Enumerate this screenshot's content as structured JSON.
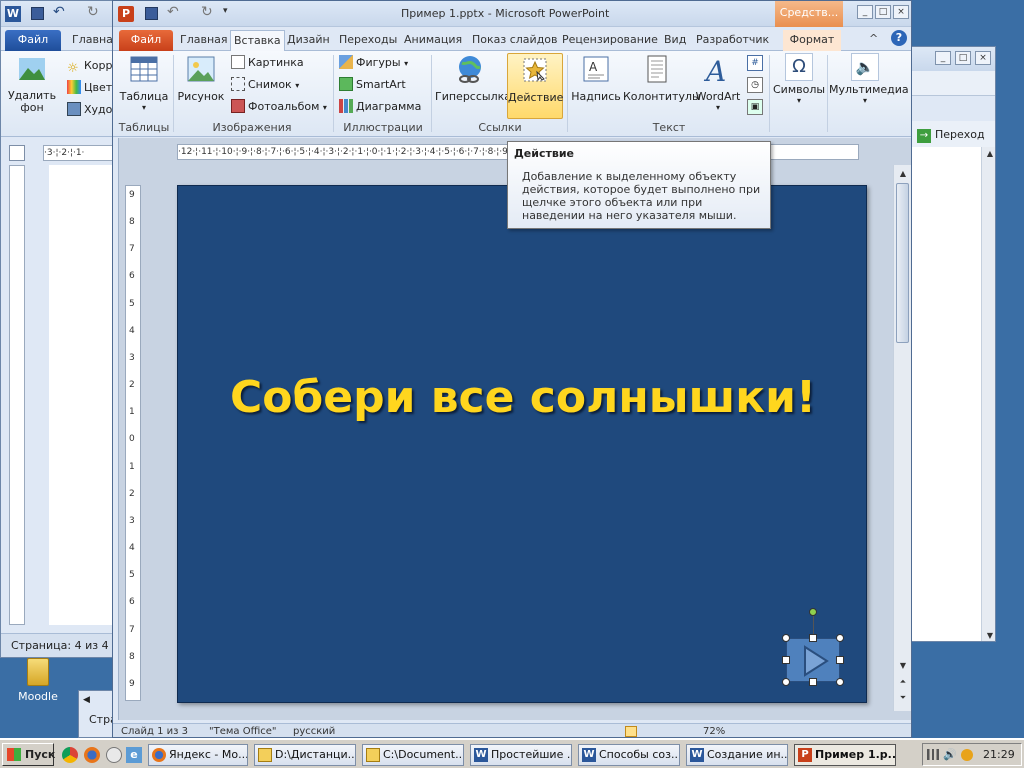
{
  "word_window": {
    "tabs": {
      "file": "Файл",
      "home": "Главная"
    },
    "ribbon": {
      "delete_bg": "Удалить фон",
      "corr": "Корр",
      "color": "Цвет",
      "art": "Худо"
    },
    "status": "Страница: 4 из 4"
  },
  "right_window": {
    "goto": "Переход"
  },
  "desktop": {
    "moodle_label": "Moodle",
    "stra": "Стра"
  },
  "ppt": {
    "title": "Пример 1.pptx - Microsoft PowerPoint",
    "context_group": "Средств...",
    "tabs": [
      {
        "label": "Файл"
      },
      {
        "label": "Главная"
      },
      {
        "label": "Вставка"
      },
      {
        "label": "Дизайн"
      },
      {
        "label": "Переходы"
      },
      {
        "label": "Анимация"
      },
      {
        "label": "Показ слайдов"
      },
      {
        "label": "Рецензирование"
      },
      {
        "label": "Вид"
      },
      {
        "label": "Разработчик"
      },
      {
        "label": "Формат"
      }
    ],
    "ribbon": {
      "tables_group": "Таблицы",
      "table_btn": "Таблица",
      "images_group": "Изображения",
      "picture_btn": "Рисунок",
      "clipart_btn": "Картинка",
      "screenshot_btn": "Снимок",
      "album_btn": "Фотоальбом",
      "illustrations_group": "Иллюстрации",
      "shapes_btn": "Фигуры",
      "smartart_btn": "SmartArt",
      "chart_btn": "Диаграмма",
      "links_group": "Ссылки",
      "hyperlink_btn": "Гиперссылка",
      "action_btn": "Действие",
      "text_group": "Текст",
      "textbox_btn": "Надпись",
      "header_btn": "Колонтитулы",
      "wordart_btn": "WordArt",
      "symbols_btn": "Символы",
      "media_btn": "Мультимедиа"
    },
    "tooltip": {
      "title": "Действие",
      "body": "Добавление к выделенному объекту действия, которое будет выполнено при щелчке этого объекта или при наведении на него указателя мыши."
    },
    "ruler_h": "·12·¦·11·¦·10·¦·9·¦·8·¦·7·¦·6·¦·5·¦·4·¦·3·¦·2·¦·1·¦·0·¦·1·¦·2·¦·3·¦·4·¦·5·¦·6·¦·7·¦·8·¦·9·¦·10·¦·11·¦·12·",
    "ruler_v": [
      "9",
      "8",
      "7",
      "6",
      "5",
      "4",
      "3",
      "2",
      "1",
      "0",
      "1",
      "2",
      "3",
      "4",
      "5",
      "6",
      "7",
      "8",
      "9"
    ],
    "slide_title": "Собери все солнышки!",
    "status": {
      "slide": "Слайд 1 из 3",
      "theme": "\"Тема Office\"",
      "lang": "русский",
      "zoom": "72%"
    }
  },
  "taskbar": {
    "start": "Пуск",
    "buttons": [
      {
        "label": "Яндекс - Мо..."
      },
      {
        "label": "D:\\Дистанци..."
      },
      {
        "label": "C:\\Document..."
      },
      {
        "label": "Простейшие ..."
      },
      {
        "label": "Способы соз..."
      },
      {
        "label": "Создание ин..."
      },
      {
        "label": "Пример 1.p..."
      }
    ],
    "time": "21:29"
  },
  "colors": {
    "slide_bg": "#1f497d",
    "slide_title": "#ffd61e",
    "file_tab": "#d0481e",
    "taskbar": "#d4d0c8"
  }
}
